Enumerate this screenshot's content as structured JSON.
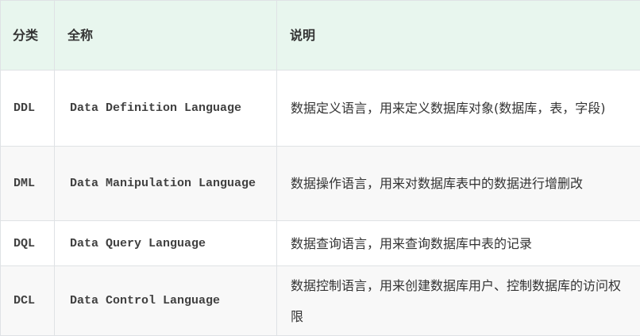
{
  "table": {
    "headers": {
      "category": "分类",
      "full_name": "全称",
      "description": "说明"
    },
    "rows": [
      {
        "code": "DDL",
        "full_name": "Data Definition Language",
        "description": "数据定义语言，用来定义数据库对象(数据库，表，字段)"
      },
      {
        "code": "DML",
        "full_name": "Data Manipulation Language",
        "description": "数据操作语言，用来对数据库表中的数据进行增删改"
      },
      {
        "code": "DQL",
        "full_name": "Data Query Language",
        "description": "数据查询语言，用来查询数据库中表的记录"
      },
      {
        "code": "DCL",
        "full_name": "Data Control Language",
        "description": "数据控制语言，用来创建数据库用户、控制数据库的访问权限"
      }
    ]
  }
}
